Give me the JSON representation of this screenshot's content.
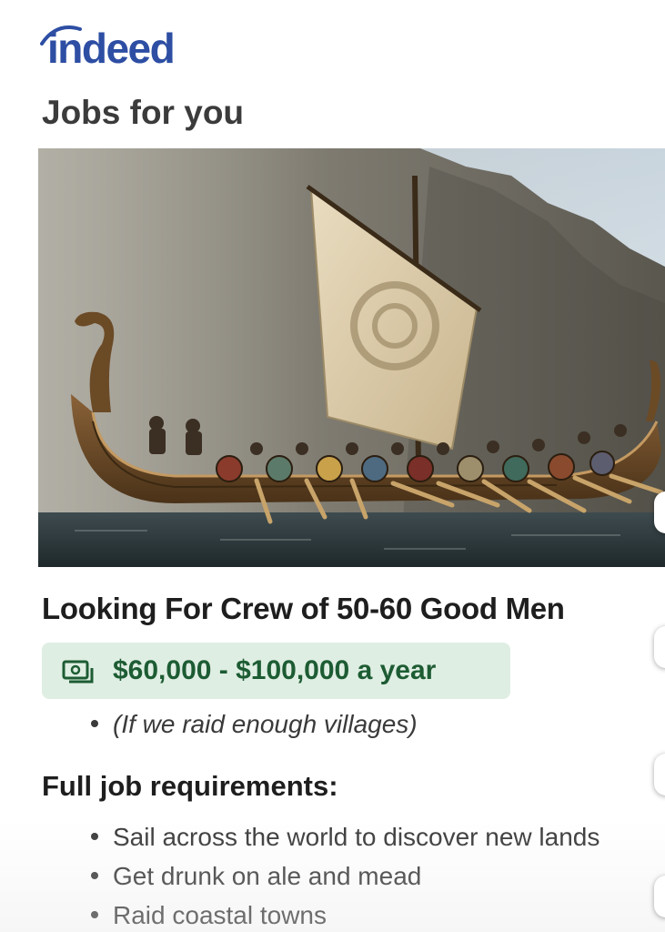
{
  "brand": {
    "name": "indeed",
    "color": "#2d4ea3"
  },
  "section_title": "Jobs for you",
  "hero_image": {
    "subject": "viking-longship"
  },
  "job": {
    "title": "Looking For Crew of 50-60 Good Men",
    "salary": "$60,000 - $100,000 a year",
    "salary_note": "(If we raid enough villages)",
    "salary_icon": "money-icon",
    "requirements_title": "Full job requirements:",
    "requirements": [
      "Sail across the world to discover new lands",
      "Get drunk on ale and mead",
      "Raid coastal towns"
    ]
  },
  "colors": {
    "salary_badge_bg": "#dfeee3",
    "salary_text": "#1d5c33"
  }
}
